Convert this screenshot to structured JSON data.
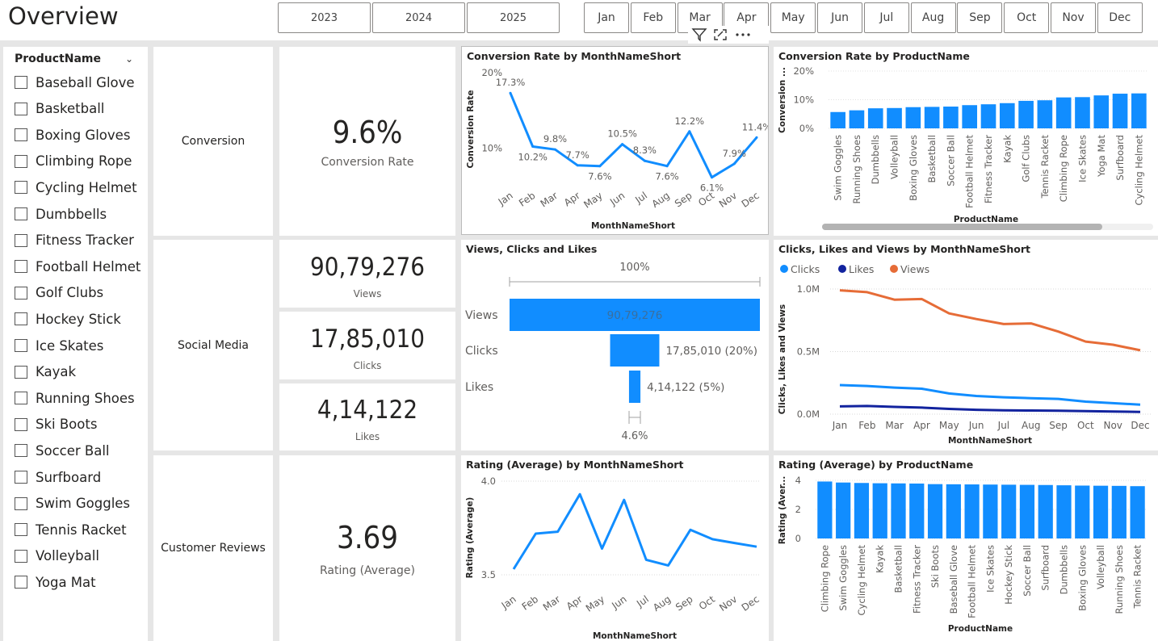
{
  "page": {
    "title": "Overview"
  },
  "years": [
    "2023",
    "2024",
    "2025"
  ],
  "months": [
    "Jan",
    "Feb",
    "Mar",
    "Apr",
    "May",
    "Jun",
    "Jul",
    "Aug",
    "Sep",
    "Oct",
    "Nov",
    "Dec"
  ],
  "slicer": {
    "header": "ProductName",
    "items": [
      "Baseball Glove",
      "Basketball",
      "Boxing Gloves",
      "Climbing Rope",
      "Cycling Helmet",
      "Dumbbells",
      "Fitness Tracker",
      "Football Helmet",
      "Golf Clubs",
      "Hockey Stick",
      "Ice Skates",
      "Kayak",
      "Running Shoes",
      "Ski Boots",
      "Soccer Ball",
      "Surfboard",
      "Swim Goggles",
      "Tennis Racket",
      "Volleyball",
      "Yoga Mat"
    ]
  },
  "sections": {
    "conversion": "Conversion",
    "social": "Social Media",
    "reviews": "Customer Reviews"
  },
  "kpis": {
    "conversion": {
      "value": "9.6%",
      "label": "Conversion Rate"
    },
    "views": {
      "value": "90,79,276",
      "label": "Views"
    },
    "clicks": {
      "value": "17,85,010",
      "label": "Clicks"
    },
    "likes": {
      "value": "4,14,122",
      "label": "Likes"
    },
    "rating": {
      "value": "3.69",
      "label": "Rating (Average)"
    }
  },
  "colors": {
    "blue": "#118dff",
    "navy": "#12239e",
    "orange": "#e66c37"
  },
  "chart_data": [
    {
      "id": "conv_month",
      "type": "line",
      "title": "Conversion Rate by MonthNameShort",
      "xlabel": "MonthNameShort",
      "ylabel": "Conversion Rate",
      "categories": [
        "Jan",
        "Feb",
        "Mar",
        "Apr",
        "May",
        "Jun",
        "Jul",
        "Aug",
        "Sep",
        "Oct",
        "Nov",
        "Dec"
      ],
      "values": [
        17.3,
        10.2,
        9.8,
        7.7,
        7.6,
        10.5,
        8.3,
        7.6,
        12.2,
        6.1,
        7.9,
        11.4
      ],
      "data_labels": [
        "17.3%",
        "10.2%",
        "9.8%",
        "7.7%",
        "7.6%",
        "10.5%",
        "8.3%",
        "7.6%",
        "12.2%",
        "6.1%",
        "7.9%",
        "11.4%"
      ],
      "yticks": [
        "10%",
        "20%"
      ],
      "ylim": [
        5,
        20
      ]
    },
    {
      "id": "conv_product",
      "type": "bar",
      "title": "Conversion Rate by ProductName",
      "xlabel": "ProductName",
      "ylabel": "Conversion ...",
      "categories": [
        "Swim Goggles",
        "Running Shoes",
        "Dumbbells",
        "Volleyball",
        "Boxing Gloves",
        "Basketball",
        "Soccer Ball",
        "Football Helmet",
        "Fitness Tracker",
        "Kayak",
        "Golf Clubs",
        "Tennis Racket",
        "Climbing Rope",
        "Ice Skates",
        "Yoga Mat",
        "Surfboard",
        "Cycling Helmet"
      ],
      "values": [
        5.7,
        6.3,
        7.0,
        7.1,
        7.4,
        7.5,
        7.6,
        8.1,
        8.4,
        8.8,
        9.6,
        9.8,
        10.8,
        10.9,
        11.5,
        12.1,
        12.2
      ],
      "yticks": [
        "0%",
        "10%",
        "20%"
      ],
      "ylim": [
        0,
        20
      ]
    },
    {
      "id": "funnel",
      "type": "bar",
      "title": "Views, Clicks and Likes",
      "categories": [
        "Views",
        "Clicks",
        "Likes"
      ],
      "values": [
        9079276,
        1785010,
        414122
      ],
      "value_labels": [
        "90,79,276",
        "17,85,010 (20%)",
        "4,14,122 (5%)"
      ],
      "top_label": "100%",
      "bottom_label": "4.6%"
    },
    {
      "id": "clv_month",
      "type": "line",
      "title": "Clicks, Likes and Views by MonthNameShort",
      "xlabel": "MonthNameShort",
      "ylabel": "Clicks, Likes and Views",
      "categories": [
        "Jan",
        "Feb",
        "Mar",
        "Apr",
        "May",
        "Jun",
        "Jul",
        "Aug",
        "Sep",
        "Oct",
        "Nov",
        "Dec"
      ],
      "series": [
        {
          "name": "Clicks",
          "values": [
            232000,
            225000,
            212000,
            203000,
            165000,
            145000,
            135000,
            128000,
            122000,
            100000,
            88000,
            76000
          ]
        },
        {
          "name": "Likes",
          "values": [
            62000,
            65000,
            58000,
            52000,
            42000,
            35000,
            31000,
            29000,
            27000,
            24000,
            21000,
            18000
          ]
        },
        {
          "name": "Views",
          "values": [
            990000,
            975000,
            915000,
            920000,
            805000,
            760000,
            720000,
            725000,
            660000,
            580000,
            555000,
            510000
          ]
        }
      ],
      "yticks": [
        "0.0M",
        "0.5M",
        "1.0M"
      ],
      "ylim": [
        0,
        1000000
      ],
      "legend": "top-left"
    },
    {
      "id": "rating_month",
      "type": "line",
      "title": "Rating (Average) by MonthNameShort",
      "xlabel": "MonthNameShort",
      "ylabel": "Rating (Average)",
      "categories": [
        "Jan",
        "Feb",
        "Mar",
        "Apr",
        "May",
        "Jun",
        "Jul",
        "Aug",
        "Sep",
        "Oct",
        "Nov",
        "Dec"
      ],
      "values": [
        3.53,
        3.72,
        3.73,
        3.93,
        3.64,
        3.9,
        3.58,
        3.55,
        3.74,
        3.69,
        3.67,
        3.65
      ],
      "yticks": [
        "3.5",
        "4.0"
      ],
      "ylim": [
        3.5,
        4.0
      ]
    },
    {
      "id": "rating_product",
      "type": "bar",
      "title": "Rating (Average) by ProductName",
      "xlabel": "ProductName",
      "ylabel": "Rating (Aver...",
      "categories": [
        "Climbing Rope",
        "Swim Goggles",
        "Cycling Helmet",
        "Kayak",
        "Basketball",
        "Fitness Tracker",
        "Ski Boots",
        "Baseball Glove",
        "Football Helmet",
        "Ice Skates",
        "Hockey Stick",
        "Soccer Ball",
        "Surfboard",
        "Dumbbells",
        "Boxing Gloves",
        "Volleyball",
        "Running Shoes",
        "Tennis Racket"
      ],
      "values": [
        3.92,
        3.85,
        3.82,
        3.8,
        3.79,
        3.78,
        3.74,
        3.73,
        3.72,
        3.71,
        3.7,
        3.69,
        3.68,
        3.66,
        3.64,
        3.63,
        3.62,
        3.6
      ],
      "yticks": [
        "0",
        "2",
        "4"
      ],
      "ylim": [
        0,
        4
      ]
    }
  ]
}
